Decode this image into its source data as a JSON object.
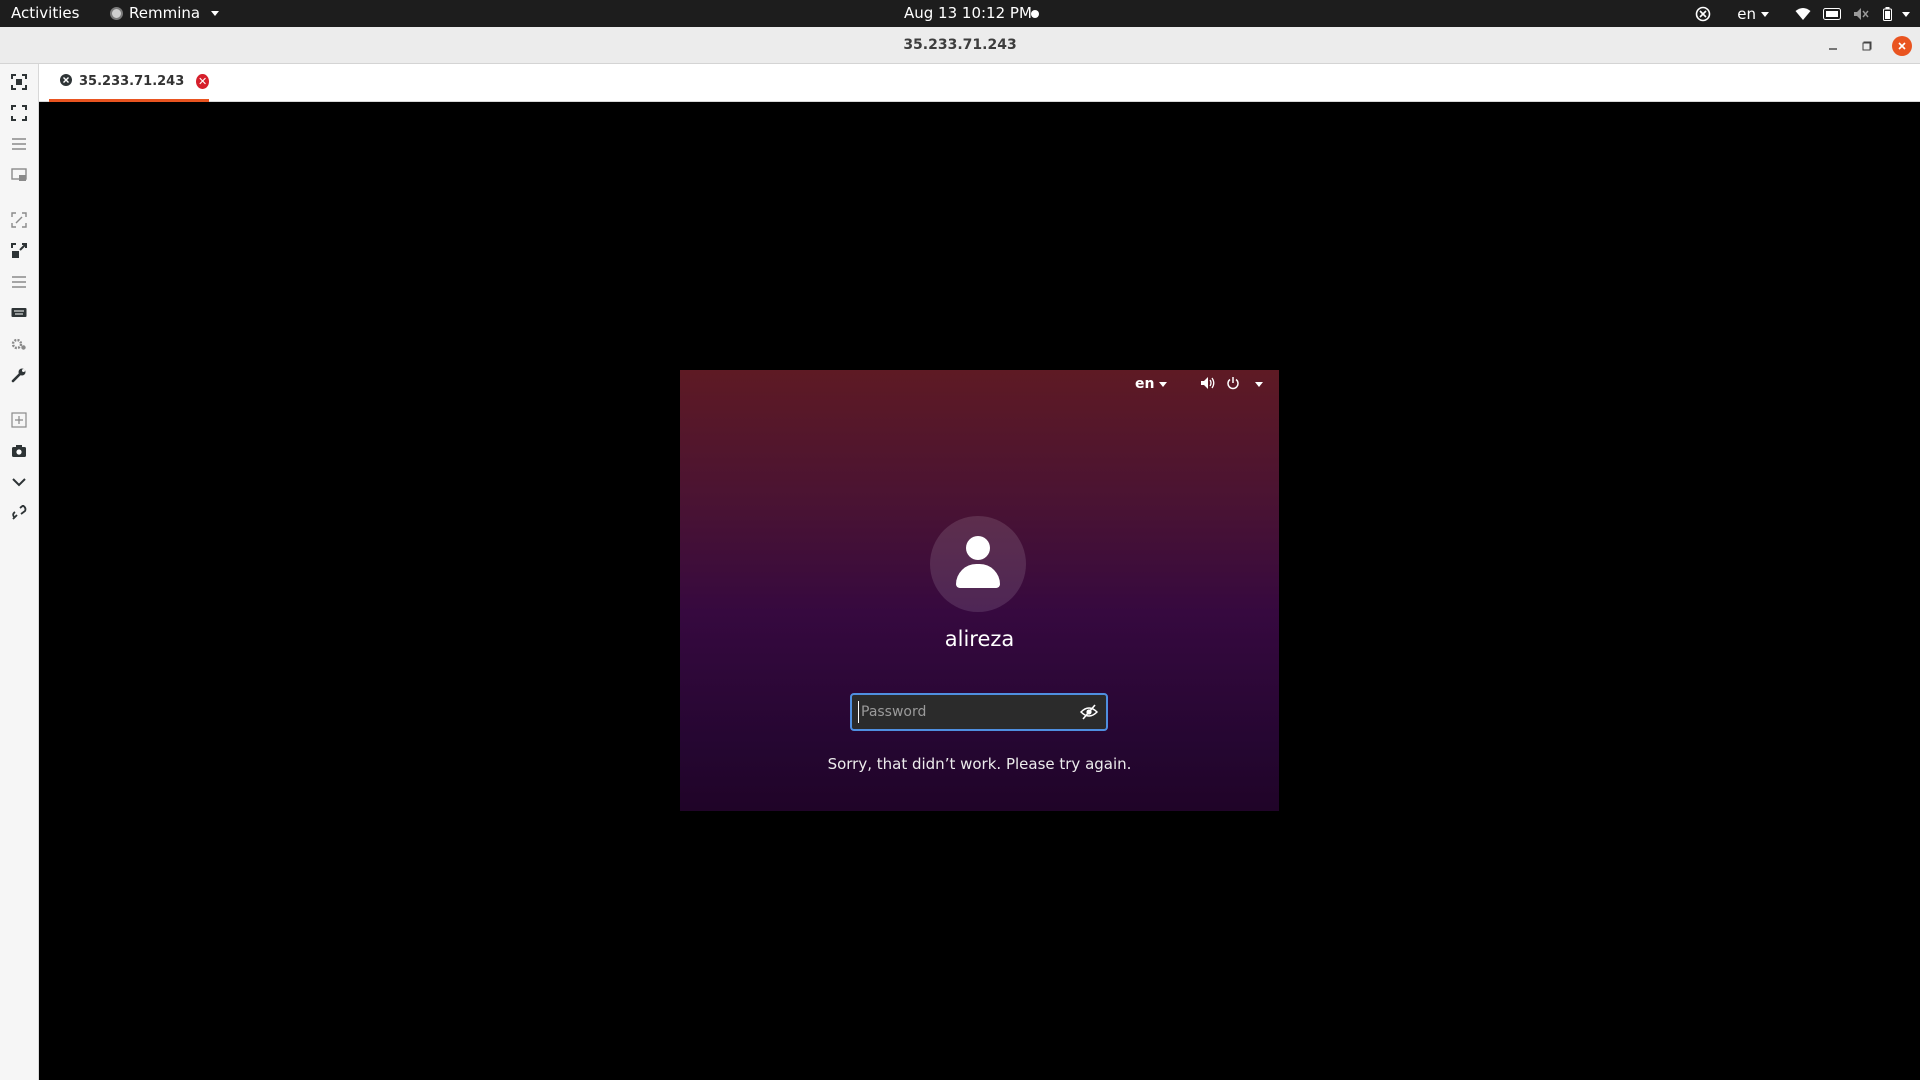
{
  "topbar": {
    "activities": "Activities",
    "app_name": "Remmina",
    "clock": "Aug 13  10:12 PM",
    "language": "en"
  },
  "window": {
    "title": "35.233.71.243",
    "minimize_icon": "minimize-icon",
    "maximize_icon": "maximize-icon",
    "close_icon": "close-icon"
  },
  "tab": {
    "label": "35.233.71.243",
    "close_icon": "tab-close-icon"
  },
  "sidebar": {
    "tools": [
      "fit-window-icon",
      "fullscreen-icon",
      "menu-icon",
      "multi-monitor-icon",
      "scale-icon",
      "dynamic-resolution-icon",
      "menu-icon",
      "keyboard-icon",
      "preferences-icon",
      "tools-icon",
      "duplicate-icon",
      "screenshot-icon",
      "minimize-toolbar-icon",
      "disconnect-icon"
    ]
  },
  "login": {
    "language": "en",
    "username": "alireza",
    "password_placeholder": "Password",
    "error_message": "Sorry, that didn’t work. Please try again."
  },
  "colors": {
    "accent": "#e95420",
    "focus_border": "#4f8fe0",
    "login_gradient_top": "#5e1a24",
    "login_gradient_bottom": "#200428"
  }
}
